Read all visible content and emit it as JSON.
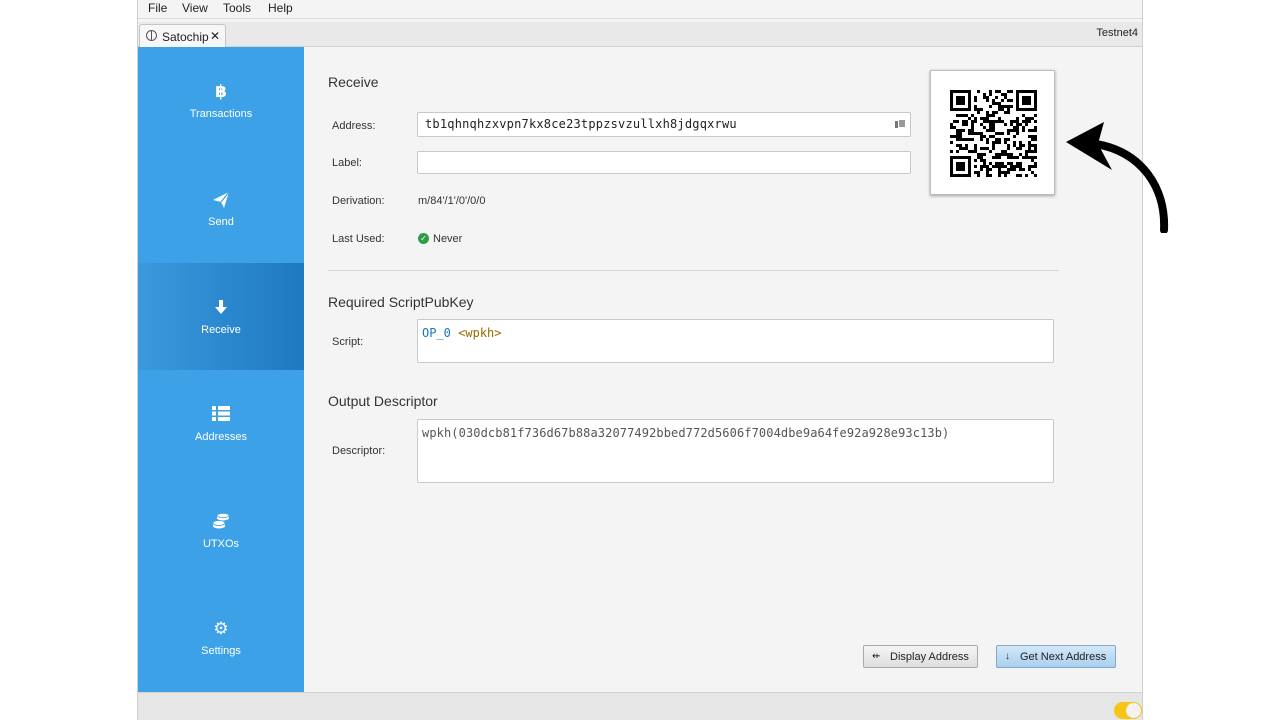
{
  "menu": [
    "File",
    "View",
    "Tools",
    "Help"
  ],
  "tab": {
    "label": "Satochip",
    "close": "✕",
    "network": "Testnet4"
  },
  "sidebar": {
    "items": [
      {
        "icon": "bitcoin-icon",
        "glyph": "฿",
        "label": "Transactions"
      },
      {
        "icon": "send-icon",
        "glyph": "➤",
        "label": "Send"
      },
      {
        "icon": "receive-icon",
        "glyph": "↓",
        "label": "Receive"
      },
      {
        "icon": "addresses-icon",
        "glyph": "☰",
        "label": "Addresses"
      },
      {
        "icon": "coins-icon",
        "glyph": "⛁",
        "label": "UTXOs"
      },
      {
        "icon": "settings-icon",
        "glyph": "⚙",
        "label": "Settings"
      }
    ],
    "active": "Receive"
  },
  "receive": {
    "title": "Receive",
    "address_label": "Address:",
    "address_value": "tb1qhnqhzxvpn7kx8ce23tppzsvzullxh8jdgqxrwu",
    "label_label": "Label:",
    "label_value": "",
    "derivation_label": "Derivation:",
    "derivation_value": "m/84'/1'/0'/0/0",
    "last_used_label": "Last Used:",
    "last_used_value": "Never"
  },
  "script_section": {
    "title": "Required ScriptPubKey",
    "script_label": "Script:",
    "op": "OP_0",
    "arg": "<wpkh>"
  },
  "descriptor_section": {
    "title": "Output Descriptor",
    "descriptor_label": "Descriptor:",
    "descriptor_value": "wpkh(030dcb81f736d67b88a32077492bbed772d5606f7004dbe9a64fe92a928e93c13b)"
  },
  "buttons": {
    "display_address": "Display Address",
    "get_next_address": "Get Next Address"
  },
  "colors": {
    "sidebar": "#3da1e8",
    "active_nav": "#1e79c1",
    "annotation_arrow": "#000000",
    "toggle": "#f6c517"
  }
}
